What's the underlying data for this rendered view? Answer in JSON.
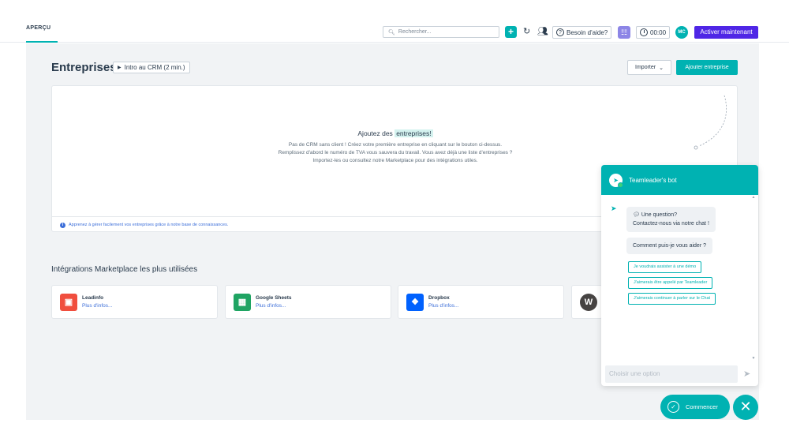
{
  "nav": {
    "tab_label": "APERÇU"
  },
  "header": {
    "search_placeholder": "Rechercher...",
    "add_label": "+",
    "help_label": "Besoin d'aide?",
    "timer_value": "00:00",
    "avatar_initials": "MC",
    "activate_label": "Activer maintenant"
  },
  "page": {
    "title": "Entreprises",
    "intro_label": "Intro au CRM (2 min.)",
    "import_label": "Importer",
    "add_company_label": "Ajouter entreprise"
  },
  "empty_state": {
    "title_prefix": "Ajoutez des",
    "title_highlight": "entreprises!",
    "description": "Pas de CRM sans client ! Créez votre première entreprise en cliquant sur le bouton ci-dessus. Remplissez d'abord le numéro de TVA vous sauvera du travail. Vous avez déjà une liste d'entreprises ? Importez-les ou consultez notre Marketplace pour des intégrations utiles.",
    "footer_text": "Apprenez à gérer facilement vos entreprises grâce à notre base de connaissances."
  },
  "marketplace": {
    "title": "Intégrations Marketplace les plus utilisées",
    "items": [
      {
        "name": "Leadinfo",
        "more": "Plus d'infos...",
        "color": "#f04e3e"
      },
      {
        "name": "Google Sheets",
        "more": "Plus d'infos...",
        "color": "#1fa463"
      },
      {
        "name": "Dropbox",
        "more": "Plus d'infos...",
        "color": "#0061fe"
      },
      {
        "name": "",
        "more": "",
        "color": "#464342"
      }
    ]
  },
  "chat": {
    "bot_name": "Teamleader's bot",
    "message_1_line_1": "Une question?",
    "message_1_line_2": "Contactez-nous via notre chat !",
    "message_2": "Comment puis-je vous aider ?",
    "options": [
      "Je voudrais assister à une démo",
      "J'aimerais être appelé par Teamleader",
      "J'aimerais continuer à parler sur le Chat"
    ],
    "input_placeholder": "Choisir une option",
    "start_label": "Commencer"
  },
  "colors": {
    "accent": "#00b2b2",
    "primary_cta": "#4f26e6",
    "link": "#3d6fd9"
  }
}
